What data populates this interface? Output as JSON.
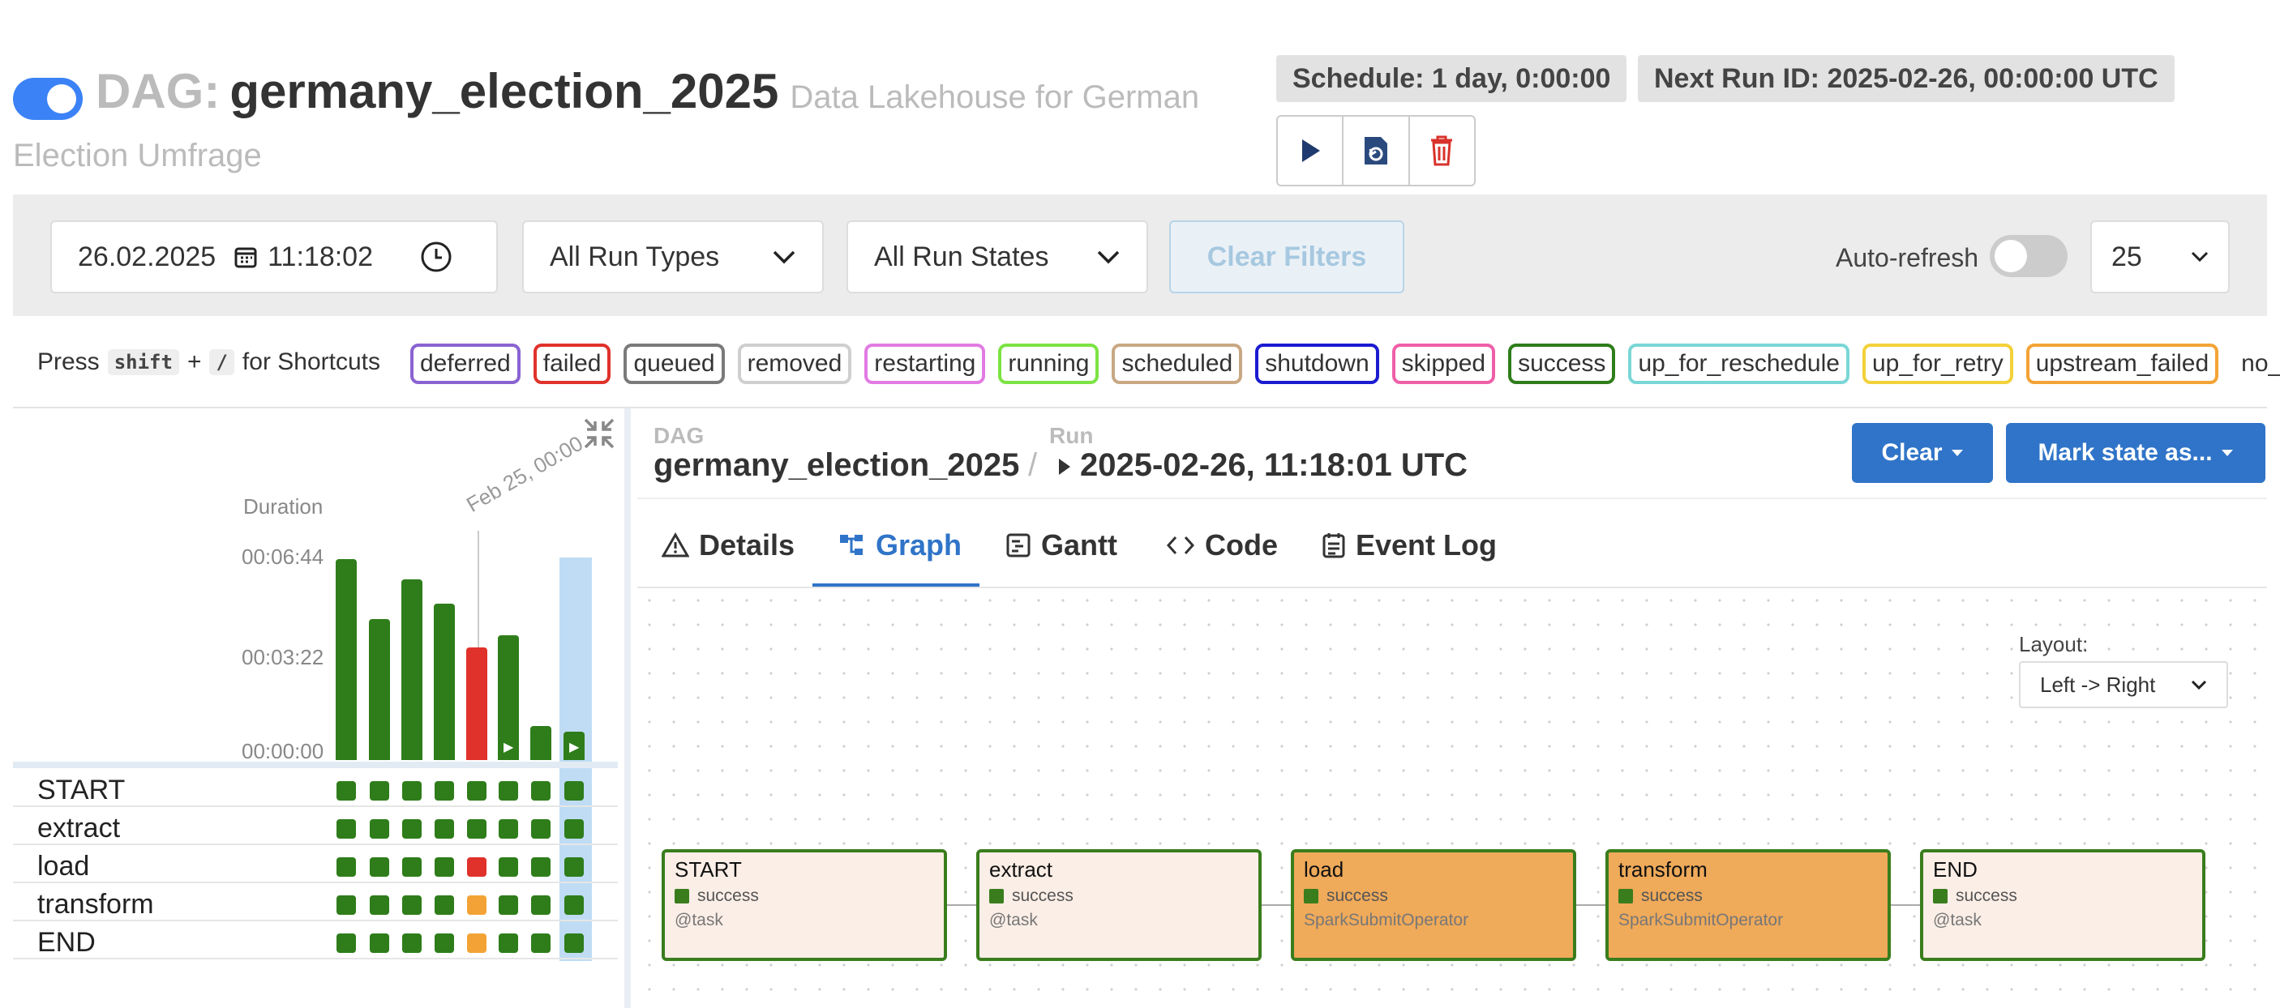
{
  "header": {
    "dag_prefix": "DAG:",
    "dag_id": "germany_election_2025",
    "description_line1": "Data Lakehouse for German",
    "description_line2": "Election Umfrage",
    "schedule": "Schedule: 1 day, 0:00:00",
    "next_run": "Next Run ID: 2025-02-26, 00:00:00 UTC",
    "actions": [
      "play-icon",
      "reparse-icon",
      "trash-icon"
    ],
    "paused": false
  },
  "filters": {
    "date": "26.02.2025",
    "time": "11:18:02",
    "run_types": "All Run Types",
    "run_states": "All Run States",
    "clear_filters": "Clear Filters",
    "auto_refresh_label": "Auto-refresh",
    "auto_refresh": false,
    "page_size": "25"
  },
  "shortcuts": {
    "press": "Press",
    "key1": "shift",
    "plus": "+",
    "key2": "/",
    "suffix": "for Shortcuts"
  },
  "legend": [
    {
      "label": "deferred",
      "color": "#8a63d2"
    },
    {
      "label": "failed",
      "color": "#e0322b"
    },
    {
      "label": "queued",
      "color": "#7a7a7a"
    },
    {
      "label": "removed",
      "color": "#cfcfcf"
    },
    {
      "label": "restarting",
      "color": "#e27be3"
    },
    {
      "label": "running",
      "color": "#7be343"
    },
    {
      "label": "scheduled",
      "color": "#c8a883"
    },
    {
      "label": "shutdown",
      "color": "#1b1bd1"
    },
    {
      "label": "skipped",
      "color": "#ef5fa8"
    },
    {
      "label": "success",
      "color": "#2e7d1a"
    },
    {
      "label": "up_for_reschedule",
      "color": "#7ad6d6"
    },
    {
      "label": "up_for_retry",
      "color": "#f3d13a"
    },
    {
      "label": "upstream_failed",
      "color": "#f3a335"
    },
    {
      "label": "no_status",
      "color": ""
    }
  ],
  "grid": {
    "duration_label": "Duration",
    "y_ticks": [
      "00:06:44",
      "00:03:22",
      "00:00:00"
    ],
    "date_marker": "Feb 25, 00:00",
    "runs": [
      {
        "duration_fraction": 1.0,
        "state": "success",
        "manual": false
      },
      {
        "duration_fraction": 0.7,
        "state": "success",
        "manual": false
      },
      {
        "duration_fraction": 0.9,
        "state": "success",
        "manual": false
      },
      {
        "duration_fraction": 0.78,
        "state": "success",
        "manual": false
      },
      {
        "duration_fraction": 0.56,
        "state": "failed",
        "manual": false
      },
      {
        "duration_fraction": 0.62,
        "state": "success",
        "manual": true
      },
      {
        "duration_fraction": 0.17,
        "state": "success",
        "manual": false
      },
      {
        "duration_fraction": 0.14,
        "state": "success",
        "manual": true
      }
    ],
    "tasks": [
      {
        "name": "START",
        "states": [
          "success",
          "success",
          "success",
          "success",
          "success",
          "success",
          "success",
          "success"
        ]
      },
      {
        "name": "extract",
        "states": [
          "success",
          "success",
          "success",
          "success",
          "success",
          "success",
          "success",
          "success"
        ]
      },
      {
        "name": "load",
        "states": [
          "success",
          "success",
          "success",
          "success",
          "failed",
          "success",
          "success",
          "success"
        ]
      },
      {
        "name": "transform",
        "states": [
          "success",
          "success",
          "success",
          "success",
          "upstream_failed",
          "success",
          "success",
          "success"
        ]
      },
      {
        "name": "END",
        "states": [
          "success",
          "success",
          "success",
          "success",
          "upstream_failed",
          "success",
          "success",
          "success"
        ]
      }
    ]
  },
  "details": {
    "dag_label": "DAG",
    "dag_id": "germany_election_2025",
    "separator": "/",
    "run_label": "Run",
    "run_id": "2025-02-26, 11:18:01 UTC",
    "clear_button": "Clear",
    "mark_button": "Mark state as...",
    "tabs": [
      {
        "label": "Details",
        "icon": "warning-icon"
      },
      {
        "label": "Graph",
        "icon": "graph-icon",
        "active": true
      },
      {
        "label": "Gantt",
        "icon": "gantt-icon"
      },
      {
        "label": "Code",
        "icon": "code-icon"
      },
      {
        "label": "Event Log",
        "icon": "log-icon"
      }
    ]
  },
  "graph": {
    "layout_label": "Layout:",
    "layout_value": "Left -> Right",
    "nodes": [
      {
        "name": "START",
        "state": "success",
        "operator": "@task",
        "fill": "#fbeee6"
      },
      {
        "name": "extract",
        "state": "success",
        "operator": "@task",
        "fill": "#fbeee6"
      },
      {
        "name": "load",
        "state": "success",
        "operator": "SparkSubmitOperator",
        "fill": "#efaa5a"
      },
      {
        "name": "transform",
        "state": "success",
        "operator": "SparkSubmitOperator",
        "fill": "#efaa5a"
      },
      {
        "name": "END",
        "state": "success",
        "operator": "@task",
        "fill": "#fbeee6"
      }
    ]
  }
}
